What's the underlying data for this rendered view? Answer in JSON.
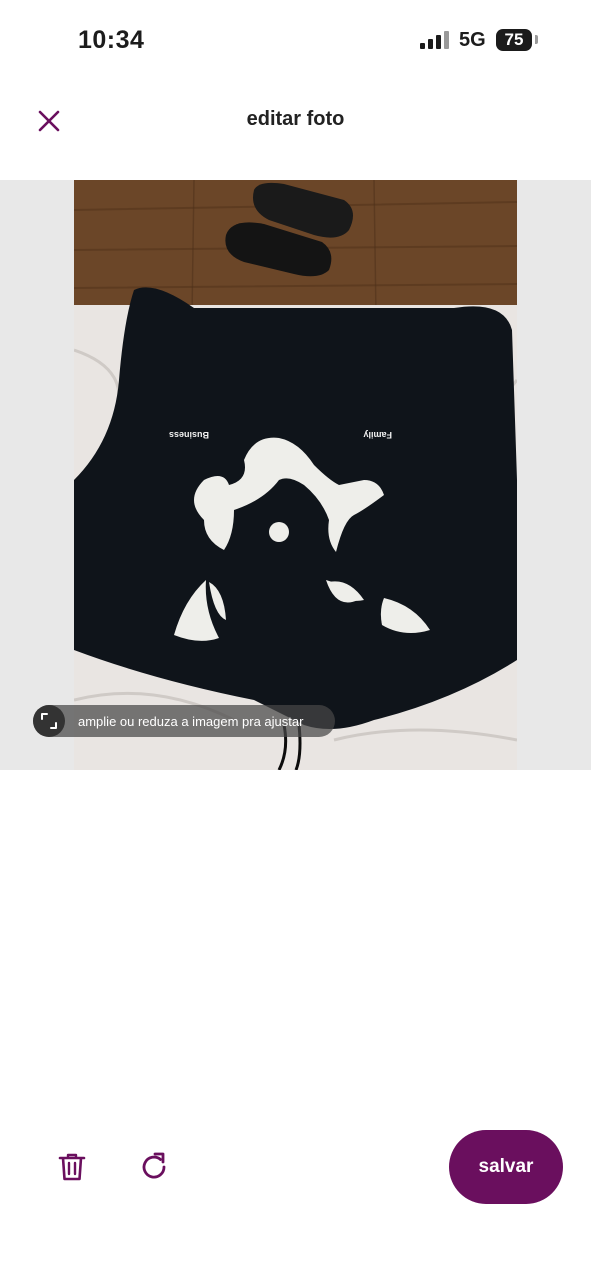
{
  "status_bar": {
    "time": "10:34",
    "network": "5G",
    "battery_level": "75",
    "signal_icon": "cellular-signal-icon",
    "battery_icon": "battery-icon"
  },
  "header": {
    "title": "editar foto",
    "close_icon": "close-icon"
  },
  "photo": {
    "hint": "amplie ou reduza a imagem pra ajustar",
    "hint_icon": "resize-icon",
    "print_text_left": "Business",
    "print_text_right": "Family"
  },
  "toolbar": {
    "delete_icon": "trash-icon",
    "rotate_icon": "rotate-icon",
    "save_label": "salvar"
  },
  "colors": {
    "accent": "#6a0f5e",
    "text": "#222222",
    "photo_background": "#e8e8e8"
  }
}
